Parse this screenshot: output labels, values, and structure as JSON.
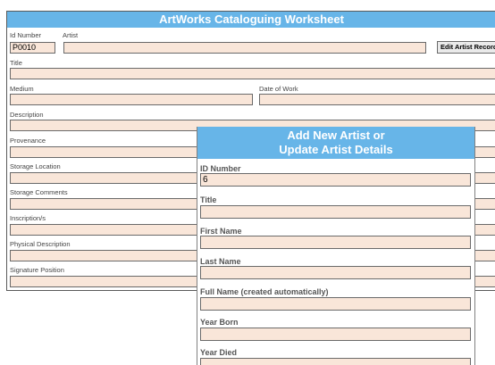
{
  "worksheet": {
    "title": "ArtWorks Cataloguing Worksheet",
    "id_number_label": "Id Number",
    "id_number_value": "P0010",
    "artist_label": "Artist",
    "artist_value": "",
    "edit_artist_button": "Edit Artist Record",
    "title_label": "Title",
    "medium_label": "Medium",
    "date_of_work_label": "Date of Work",
    "description_label": "Description",
    "provenance_label": "Provenance",
    "storage_location_label": "Storage Location",
    "storage_comments_label": "Storage Comments",
    "inscriptions_label": "Inscription/s",
    "physical_description_label": "Physical Description",
    "signature_position_label": "Signature Position"
  },
  "artist_popup": {
    "title_line1": "Add New Artist or",
    "title_line2": "Update Artist Details",
    "id_number_label": "ID Number",
    "id_number_value": "6",
    "title_label": "Title",
    "first_name_label": "First Name",
    "last_name_label": "Last Name",
    "full_name_label": "Full Name (created automatically)",
    "year_born_label": "Year Born",
    "year_died_label": "Year Died"
  },
  "colors": {
    "header_blue": "#67b5e8",
    "field_fill": "#f9e6d9"
  }
}
